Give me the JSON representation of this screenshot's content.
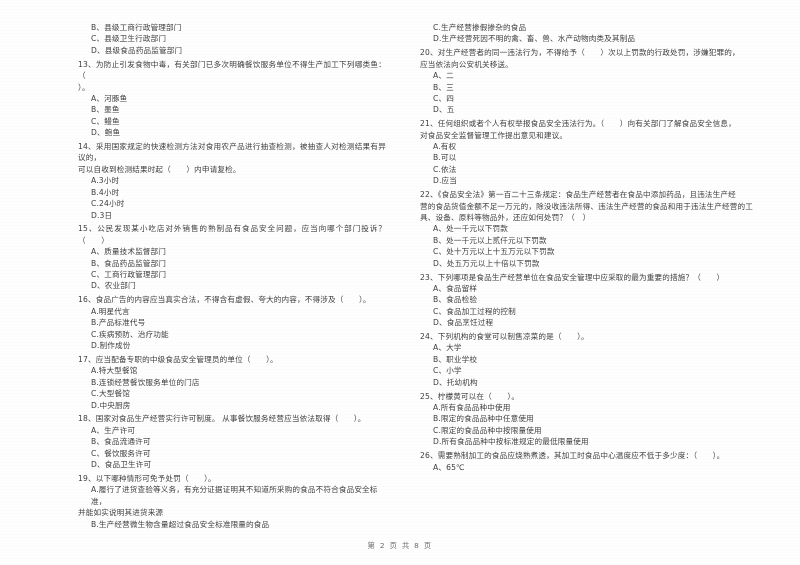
{
  "document": {
    "footer": "第 2 页 共 8 页"
  },
  "left_column": {
    "orphan_options": [
      "B、县级工商行政管理部门",
      "C、县级卫生行政部门",
      "D、县级食品药品监管部门"
    ],
    "questions": [
      {
        "number": "13",
        "text": "13、为防止引发食物中毒，有关部门已多次明确餐饮服务单位不得生产加工下列哪类鱼：（",
        "text_cont": "）。",
        "options": [
          "A、河豚鱼",
          "B、墨鱼",
          "C、鳗鱼",
          "D、鲍鱼"
        ]
      },
      {
        "number": "14",
        "text": "14、采用国家规定的快速检测方法对食用农产品进行抽查检测，被抽查人对检测结果有异议的，",
        "text_cont": "可以自收到检测结果时起（　　）内申请复检。",
        "options": [
          "A.3小时",
          "B.4小时",
          "C.24小时",
          "D.3日"
        ]
      },
      {
        "number": "15",
        "text": "15、公民发现某小吃店对外销售的熟制品有食品安全问题，应当向哪个部门投诉？（　　）",
        "text_cont": "",
        "options": [
          "A、质量技术监督部门",
          "B、食品药品监管部门",
          "C、工商行政管理部门",
          "D、农业部门"
        ]
      },
      {
        "number": "16",
        "text": "16、食品广告的内容应当真实合法，不得含有虚假、夸大的内容，不得涉及（　　）。",
        "text_cont": "",
        "options": [
          "A.明星代言",
          "B.产品标准代号",
          "C.疾病预防、治疗功能",
          "D.制作成份"
        ]
      },
      {
        "number": "17",
        "text": "17、应当配备专职的中级食品安全管理员的单位（　　）。",
        "text_cont": "",
        "options": [
          "A.特大型餐馆",
          "B.连锁经营餐饮服务单位的门店",
          "C.大型餐馆",
          "D.中央厨房"
        ]
      },
      {
        "number": "18",
        "text": "18、国家对食品生产经营实行许可制度。 从事餐饮服务经营应当依法取得（　　）。",
        "text_cont": "",
        "options": [
          "A、生产许可",
          "B、食品流通许可",
          "C、餐饮服务许可",
          "D、食品卫生许可"
        ]
      },
      {
        "number": "19",
        "text": "19、以下哪种情形可免予处罚（　　）。",
        "text_cont": "",
        "options": [
          "A.履行了进货查验等义务，有充分证据证明其不知道所采购的食品不符合食品安全标准，",
          "B.生产经营微生物含量超过食品安全标准限量的食品"
        ],
        "option_cont": "并能如实说明其进货来源"
      }
    ]
  },
  "right_column": {
    "orphan_options": [
      "C.生产经营掺假掺杂的食品",
      "D.生产经营死因不明的禽、畜、兽、水产动物肉类及其制品"
    ],
    "questions": [
      {
        "number": "20",
        "text": "20、对生产经营者的同一违法行为，不得给予（　　）次以上罚款的行政处罚，涉嫌犯罪的，",
        "text_cont": "应当依法向公安机关移送。",
        "options": [
          "A、二",
          "B、三",
          "C、四",
          "D、五"
        ]
      },
      {
        "number": "21",
        "text": "21、任何组织或者个人有权举报食品安全违法行为。（　　）向有关部门了解食品安全信息，",
        "text_cont": "对食品安全监督管理工作提出意见和建议。",
        "options": [
          "A.有权",
          "B.可以",
          "C.依法",
          "D.应当"
        ]
      },
      {
        "number": "22",
        "text": "22、《食品安全法》第一百二十三条规定：食品生产经营者在食品中添加药品，且违法生产经",
        "text_cont": "营的食品货值金额不足一万元的，除没收违法所得、违法生产经营的食品和用于违法生产经营的工具、设备、原料等物品外，还应如何处罚？（　）",
        "options": [
          "A、处一千元以下罚款",
          "B、处一千元以上贰仟元以下罚款",
          "C、处十万元以上十五万元以下罚款",
          "D、处五万元以上十倍以下罚款"
        ]
      },
      {
        "number": "23",
        "text": "23、下列哪项是食品生产经营单位在食品安全管理中应采取的最为重要的措施？（　　）",
        "text_cont": "",
        "options": [
          "A、食品留样",
          "B、食品检验",
          "C、食品加工过程的控制",
          "D、食品烹饪过程"
        ]
      },
      {
        "number": "24",
        "text": "24、下列机构的食堂可以制售凉菜的是（　　）。",
        "text_cont": "",
        "options": [
          "A、大学",
          "B、职业学校",
          "C、小学",
          "D、托幼机构"
        ]
      },
      {
        "number": "25",
        "text": "25、柠檬黄可以在（　　）。",
        "text_cont": "",
        "options": [
          "A.所有食品品种中使用",
          "B.限定的食品品种中任意使用",
          "C.限定的食品品种中按限量使用",
          "D.所有食品品种中按标准规定的最低限量使用"
        ]
      },
      {
        "number": "26",
        "text": "26、需要熟制加工的食品应烧熟煮透，其加工时食品中心温度应不低于多少度：（　　）。",
        "text_cont": "",
        "options": [
          "A、65℃"
        ]
      }
    ]
  }
}
